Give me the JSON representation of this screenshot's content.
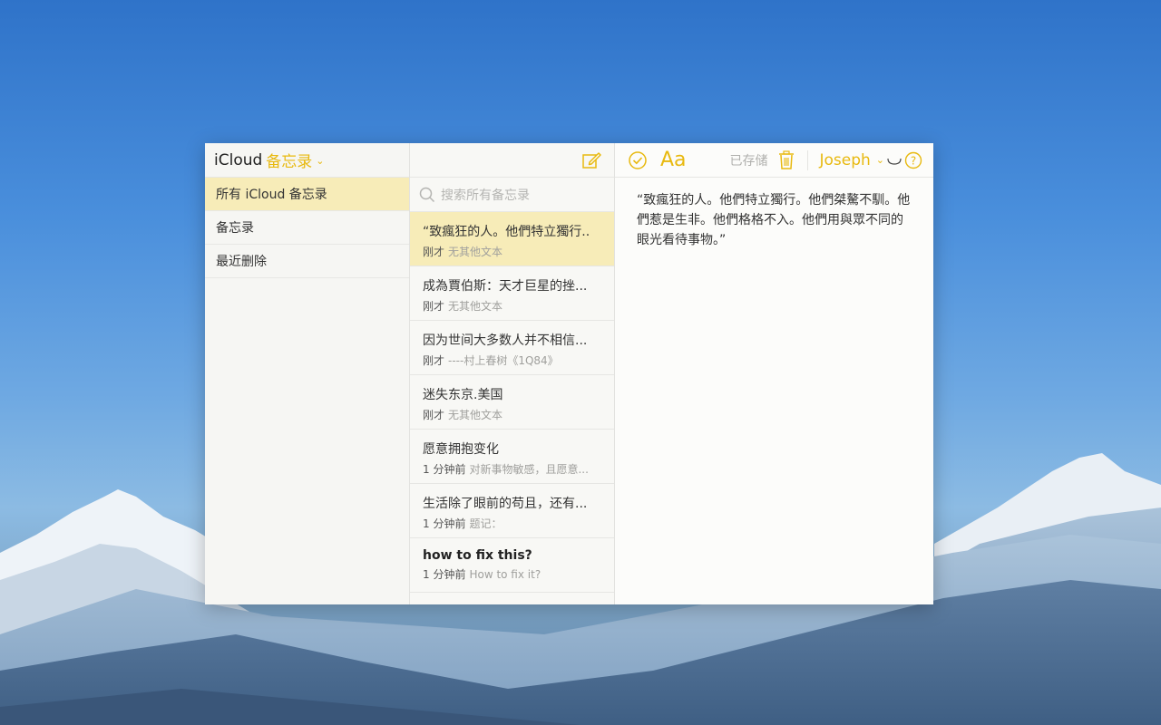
{
  "app": {
    "brand": "iCloud",
    "name": "备忘录"
  },
  "folders": [
    {
      "label": "所有 iCloud 备忘录",
      "selected": true
    },
    {
      "label": "备忘录",
      "selected": false
    },
    {
      "label": "最近删除",
      "selected": false
    }
  ],
  "search": {
    "placeholder": "搜索所有备忘录"
  },
  "notes": [
    {
      "title": "“致瘋狂的人。他們特立獨行..",
      "time": "刚才",
      "preview": "无其他文本",
      "selected": true
    },
    {
      "title": "成為賈伯斯：天才巨星的挫...",
      "time": "刚才",
      "preview": "无其他文本",
      "selected": false
    },
    {
      "title": "因为世间大多数人并不相信...",
      "time": "刚才",
      "preview": "----村上春树《1Q84》",
      "selected": false
    },
    {
      "title": "迷失东京.美国",
      "time": "刚才",
      "preview": "无其他文本",
      "selected": false
    },
    {
      "title": "愿意拥抱变化",
      "time": "1 分钟前",
      "preview": "对新事物敏感，且愿意...",
      "selected": false
    },
    {
      "title": "生活除了眼前的苟且，还有...",
      "time": "1 分钟前",
      "preview": "题记：",
      "selected": false
    },
    {
      "title": "how to fix this?",
      "time": "1 分钟前",
      "preview": "How to fix it?",
      "selected": false
    }
  ],
  "toolbar": {
    "format_label": "Aa",
    "saved_label": "已存储",
    "user_name": "Joseph"
  },
  "editor": {
    "content": "“致瘋狂的人。他們特立獨行。他們桀驁不馴。他們惹是生非。他們格格不入。他們用與眾不同的眼光看待事物。”"
  },
  "colors": {
    "accent": "#e8b90f",
    "selection": "#f7ecb8"
  },
  "icons": [
    "compose-icon",
    "search-icon",
    "checklist-icon",
    "trash-icon",
    "share-icon",
    "help-icon",
    "chevron-down-icon"
  ]
}
